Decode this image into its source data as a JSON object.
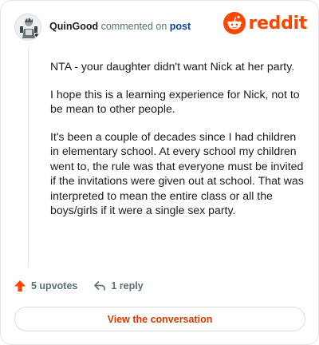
{
  "header": {
    "username": "QuinGood",
    "commented_text": "commented on",
    "post_link": "post",
    "brand": "reddit"
  },
  "comment": {
    "paragraphs": [
      "NTA - your daughter didn't want Nick at her party.",
      "I hope this is a learning experience for Nick, not to be mean to other people.",
      "It's been a couple of decades since I had children in elementary school. At every school my children went to, the rule was that everyone must be invited if the invitations were given out at school. That was interpreted to mean the entire class or all the boys/girls if it were a single sex party."
    ]
  },
  "actions": {
    "upvotes_label": "5 upvotes",
    "reply_label": "1 reply"
  },
  "footer": {
    "view_button_label": "View the conversation"
  },
  "colors": {
    "brand": "#ff4500",
    "link": "#0a449b",
    "button_text": "#d93a00"
  }
}
